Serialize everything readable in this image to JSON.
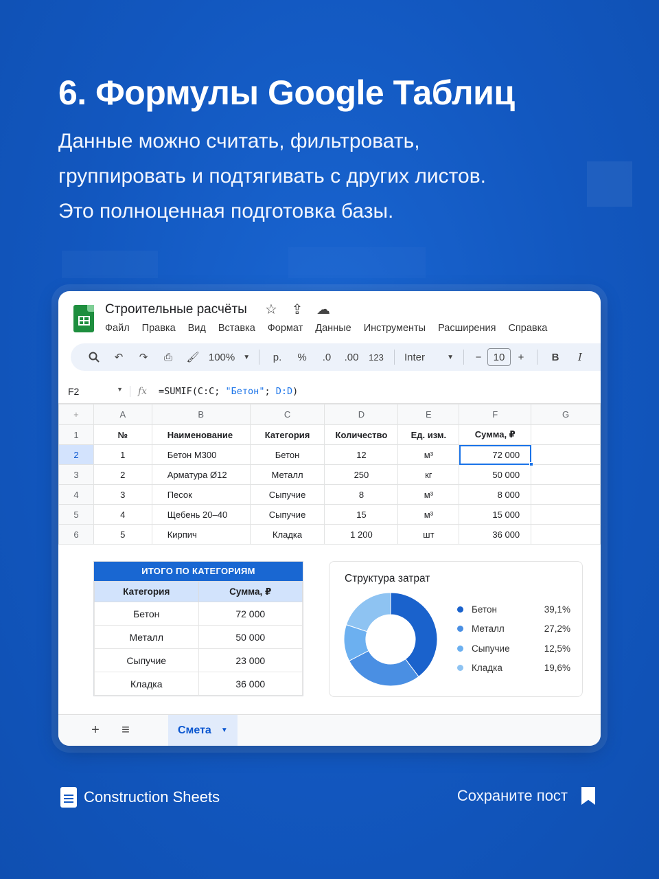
{
  "headline": "6. Формулы Google Таблиц",
  "subtitle": [
    "Данные можно считать, фильтровать,",
    "группировать и подтягивать с других листов.",
    "Это полноценная подготовка базы."
  ],
  "app": {
    "doc_title": "Строительные расчёты",
    "menu": [
      "Файл",
      "Правка",
      "Вид",
      "Вставка",
      "Формат",
      "Данные",
      "Инструменты",
      "Расширения",
      "Справка"
    ],
    "toolbar": {
      "zoom": "100%",
      "currency": "р.",
      "percent": "%",
      "dec_decrease": ".0",
      "dec_increase": ".00",
      "number_format": "123",
      "font": "Inter",
      "font_size": "10",
      "bold": "B",
      "italic": "I"
    },
    "formula_bar": {
      "cell_ref": "F2",
      "fx": "fx",
      "formula_fn": "=SUMIF(",
      "formula_ref1": "C:C; ",
      "formula_str": "\"Бетон\"",
      "formula_sep": "; ",
      "formula_ref2": "D:D",
      "formula_end": ")"
    },
    "grid": {
      "corner": "+",
      "columns": [
        "A",
        "B",
        "C",
        "D",
        "E",
        "F",
        "G"
      ],
      "rows": [
        "1",
        "2",
        "3",
        "4",
        "5",
        "6"
      ],
      "header": [
        "№",
        "Наименование",
        "Категория",
        "Количество",
        "Ед. изм.",
        "Сумма, ₽"
      ],
      "data": [
        [
          "1",
          "Бетон М300",
          "Бетон",
          "12",
          "м³",
          "72 000"
        ],
        [
          "2",
          "Арматура Ø12",
          "Металл",
          "250",
          "кг",
          "50 000"
        ],
        [
          "3",
          "Песок",
          "Сыпучие",
          "8",
          "м³",
          "8 000"
        ],
        [
          "4",
          "Щебень 20–40",
          "Сыпучие",
          "15",
          "м³",
          "15 000"
        ],
        [
          "5",
          "Кирпич",
          "Кладка",
          "1 200",
          "шт",
          "36 000"
        ]
      ]
    },
    "summary": {
      "title": "ИТОГО ПО КАТЕГОРИЯМ",
      "headers": [
        "Категория",
        "Сумма, ₽"
      ],
      "rows": [
        [
          "Бетон",
          "72 000"
        ],
        [
          "Металл",
          "50 000"
        ],
        [
          "Сыпучие",
          "23 000"
        ],
        [
          "Кладка",
          "36 000"
        ]
      ]
    },
    "chart_data": {
      "type": "pie",
      "title": "Структура затрат",
      "categories": [
        "Бетон",
        "Металл",
        "Сыпучие",
        "Кладка"
      ],
      "values": [
        39.1,
        27.2,
        12.5,
        19.6
      ],
      "labels": [
        "39,1%",
        "27,2%",
        "12,5%",
        "19,6%"
      ],
      "colors": [
        "#1a62cc",
        "#4a8fe3",
        "#6cb0f0",
        "#8ec3f2"
      ],
      "legend": "right"
    },
    "tabs": {
      "add": "+",
      "list": "≡",
      "active_sheet": "Смета",
      "caret": "▼"
    }
  },
  "footer": {
    "brand": "Construction Sheets",
    "save": "Сохраните пост"
  }
}
